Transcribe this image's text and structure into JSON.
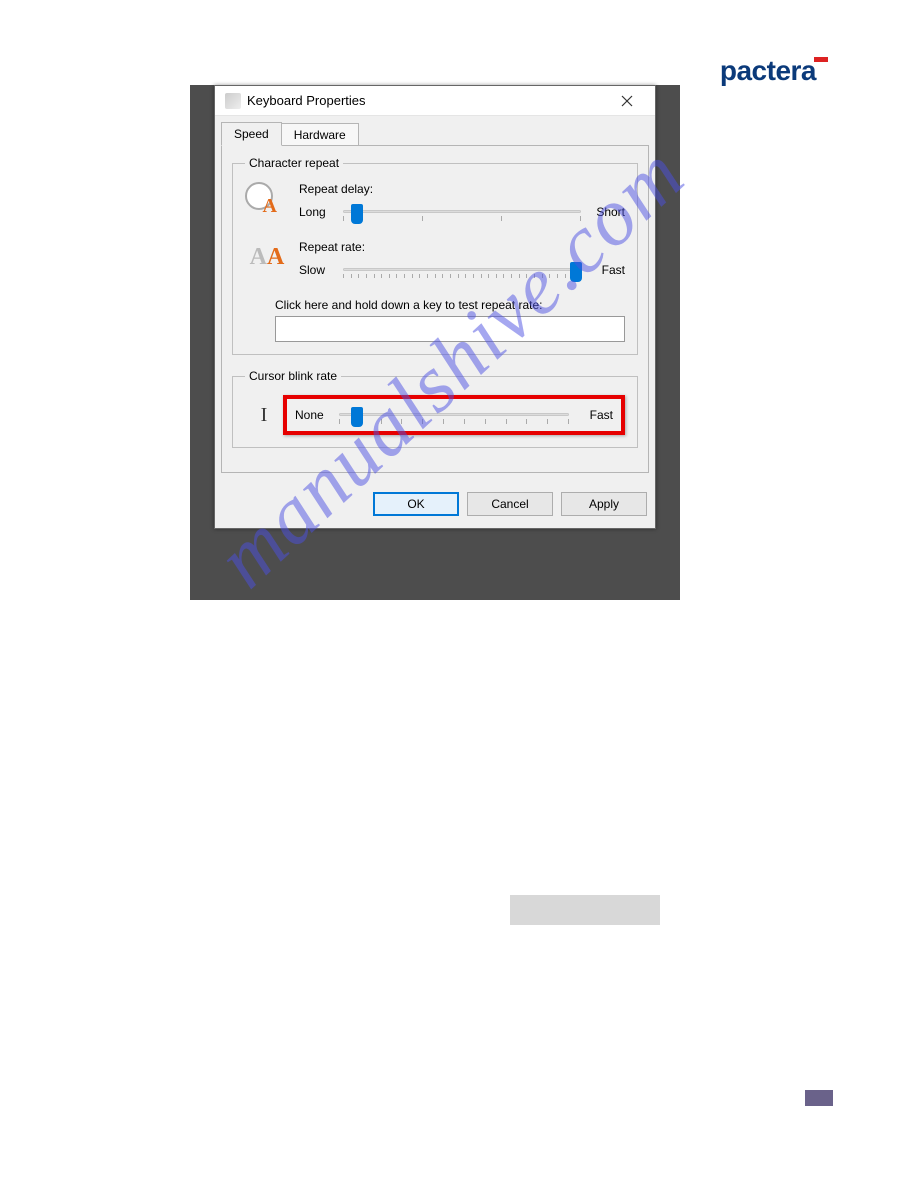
{
  "brand": "pactera",
  "watermark": "manualshive.com",
  "dialog": {
    "title": "Keyboard Properties",
    "tabs": {
      "speed": "Speed",
      "hardware": "Hardware"
    },
    "charRepeat": {
      "legend": "Character repeat",
      "delay": {
        "label": "Repeat delay:",
        "min": "Long",
        "max": "Short"
      },
      "rate": {
        "label": "Repeat rate:",
        "min": "Slow",
        "max": "Fast"
      },
      "testLabel": "Click here and hold down a key to test repeat rate:"
    },
    "blink": {
      "legend": "Cursor blink rate",
      "min": "None",
      "max": "Fast"
    },
    "buttons": {
      "ok": "OK",
      "cancel": "Cancel",
      "apply": "Apply"
    }
  }
}
